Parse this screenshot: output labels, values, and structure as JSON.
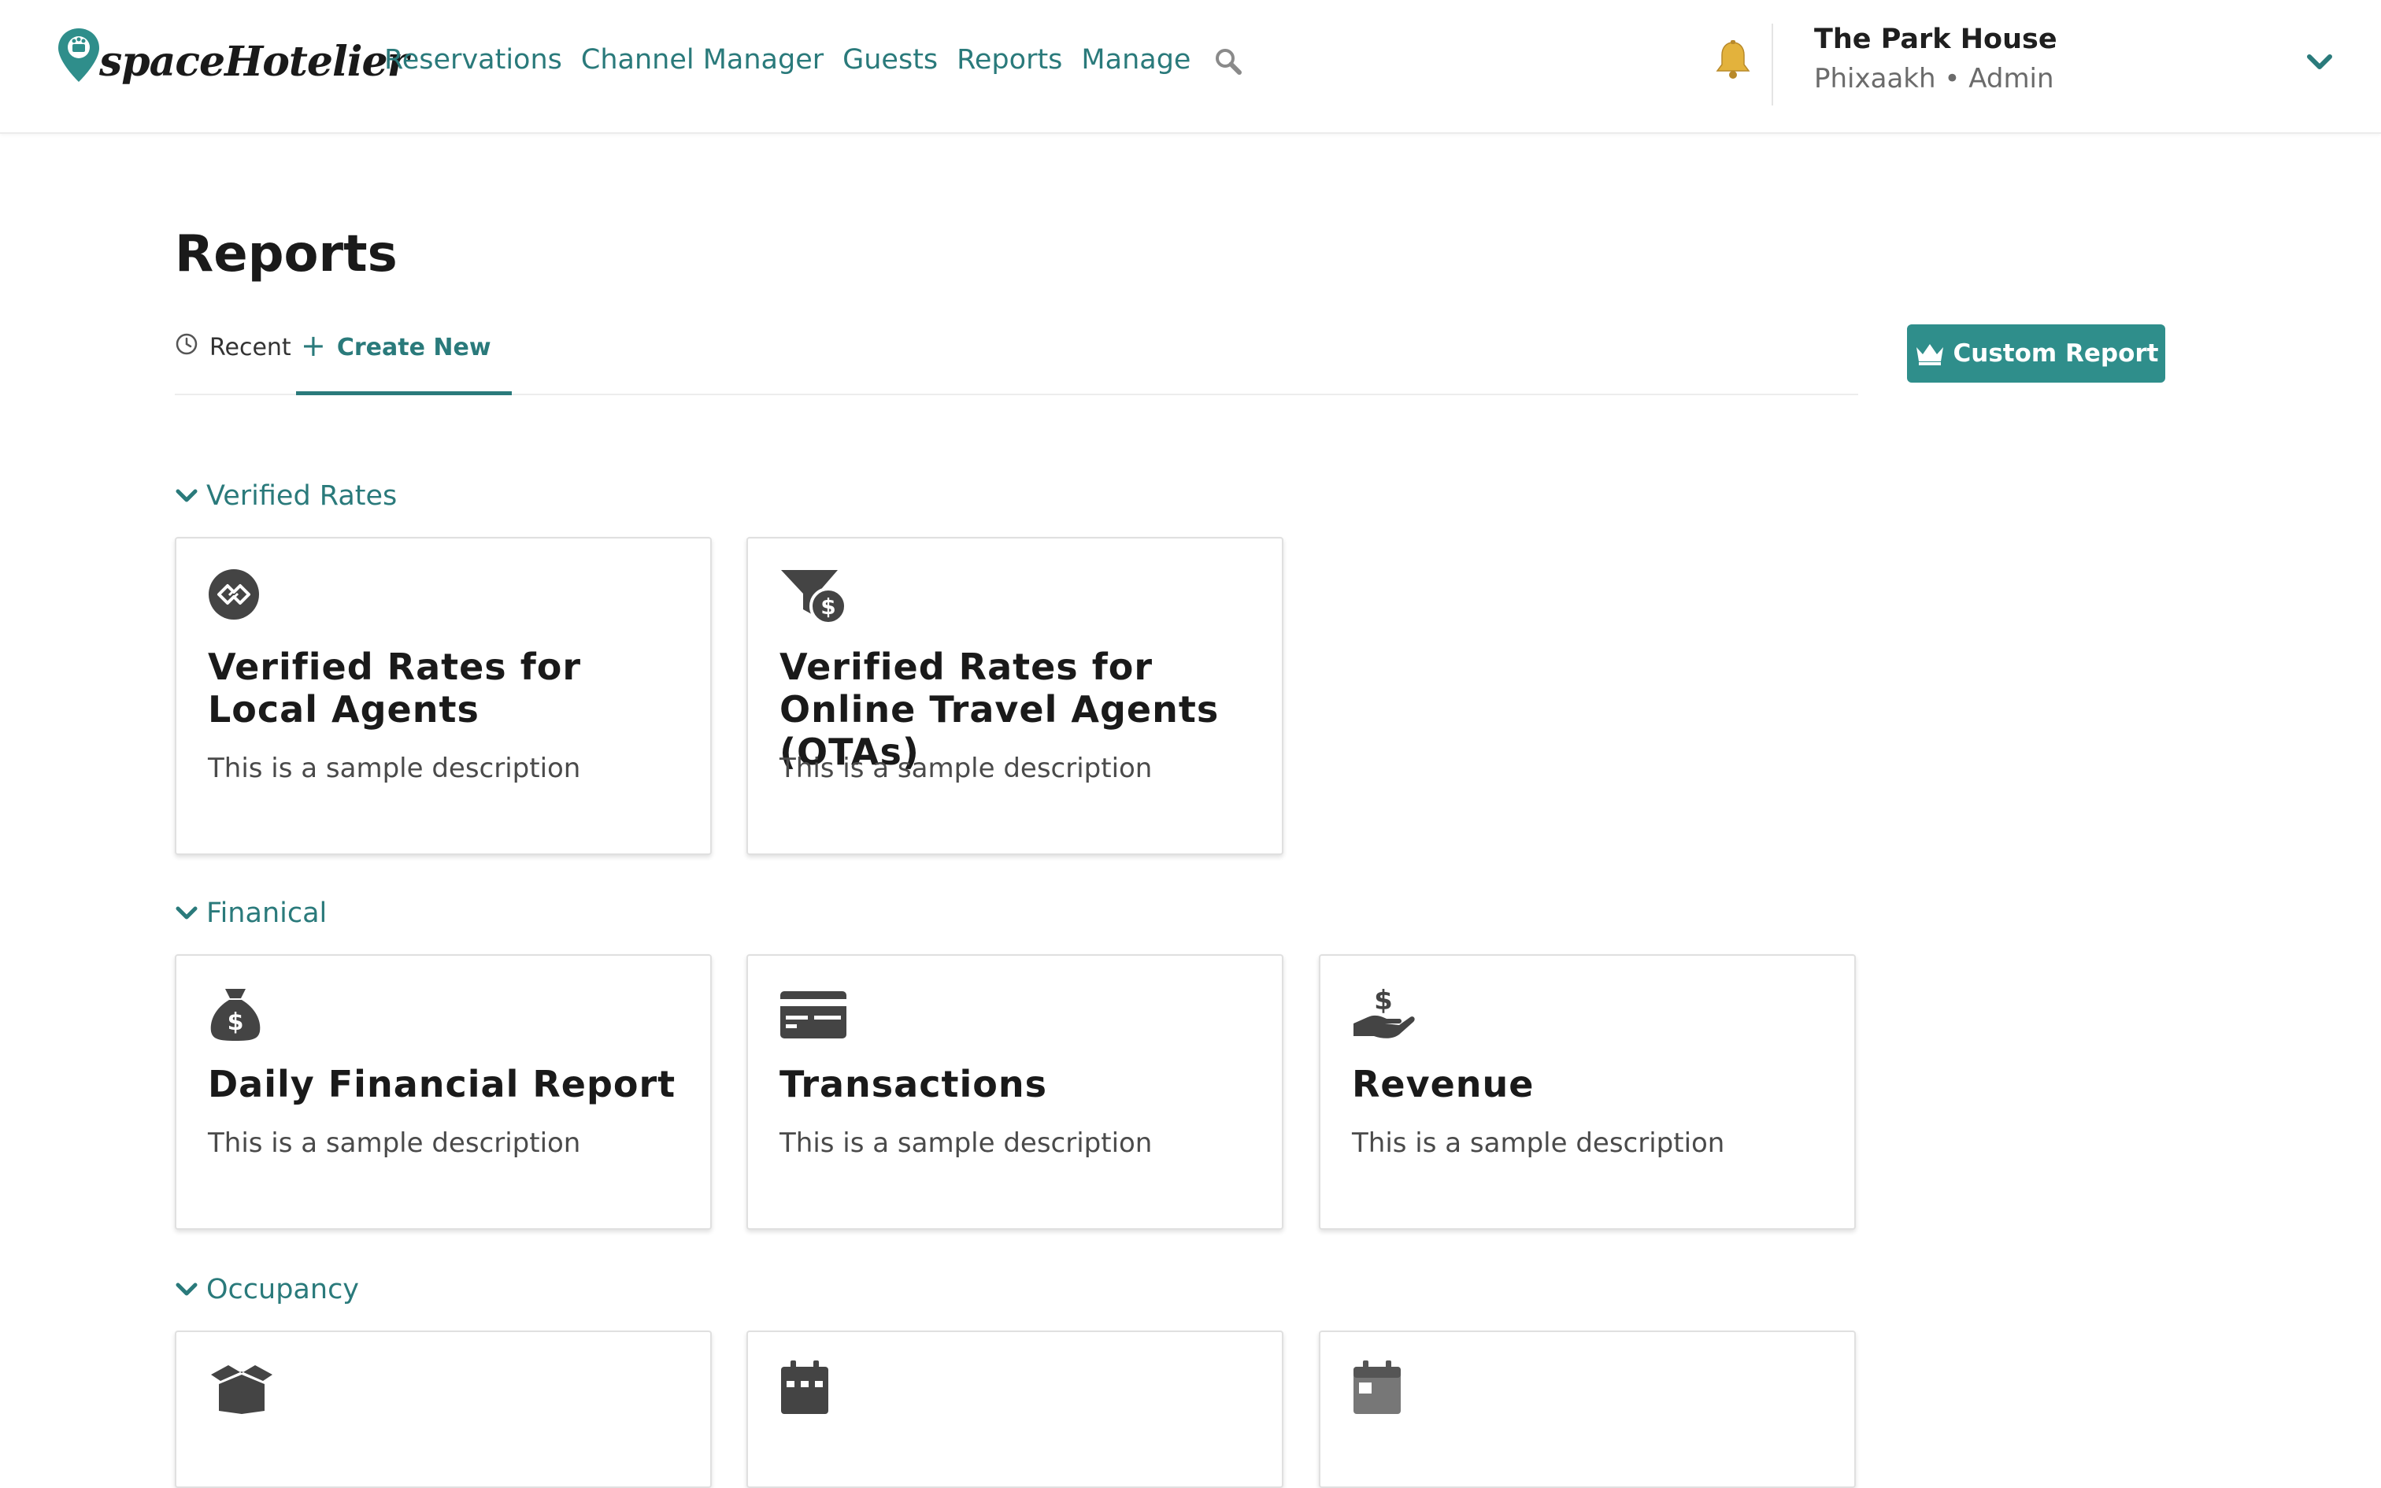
{
  "brand": {
    "name": "spaceHotelier",
    "accent_color": "#2a7a7b"
  },
  "nav": {
    "items": [
      "Reservations",
      "Channel Manager",
      "Guests",
      "Reports",
      "Manage"
    ],
    "search_icon": "search-icon"
  },
  "account": {
    "hotel": "The Park House",
    "user": "Phixaakh • Admin"
  },
  "page": {
    "title": "Reports",
    "tabs": [
      {
        "label": "Recent",
        "icon": "clock-icon",
        "active": false
      },
      {
        "label": "Create New",
        "icon": "plus-icon",
        "active": true
      }
    ],
    "custom_report_label": "Custom Report",
    "button_color": "#2f8e8b"
  },
  "sections": [
    {
      "title": "Verified Rates",
      "cards": [
        {
          "title": "Verified Rates for Local Agents",
          "desc": "This is a sample description",
          "icon": "handshake-icon"
        },
        {
          "title": "Verified Rates for Online Travel Agents (OTAs)",
          "desc": "This is a sample description",
          "icon": "funnel-dollar-icon"
        }
      ]
    },
    {
      "title": "Finanical",
      "cards": [
        {
          "title": "Daily Financial Report",
          "desc": "This is a sample description",
          "icon": "money-bag-icon"
        },
        {
          "title": "Transactions",
          "desc": "This is a sample description",
          "icon": "credit-card-icon"
        },
        {
          "title": "Revenue",
          "desc": "This is a sample description",
          "icon": "hand-dollar-icon"
        }
      ]
    },
    {
      "title": "Occupancy",
      "cards": [
        {
          "icon": "box-open-icon"
        },
        {
          "icon": "calendar-icon"
        },
        {
          "icon": "calendar-day-icon"
        }
      ]
    }
  ]
}
